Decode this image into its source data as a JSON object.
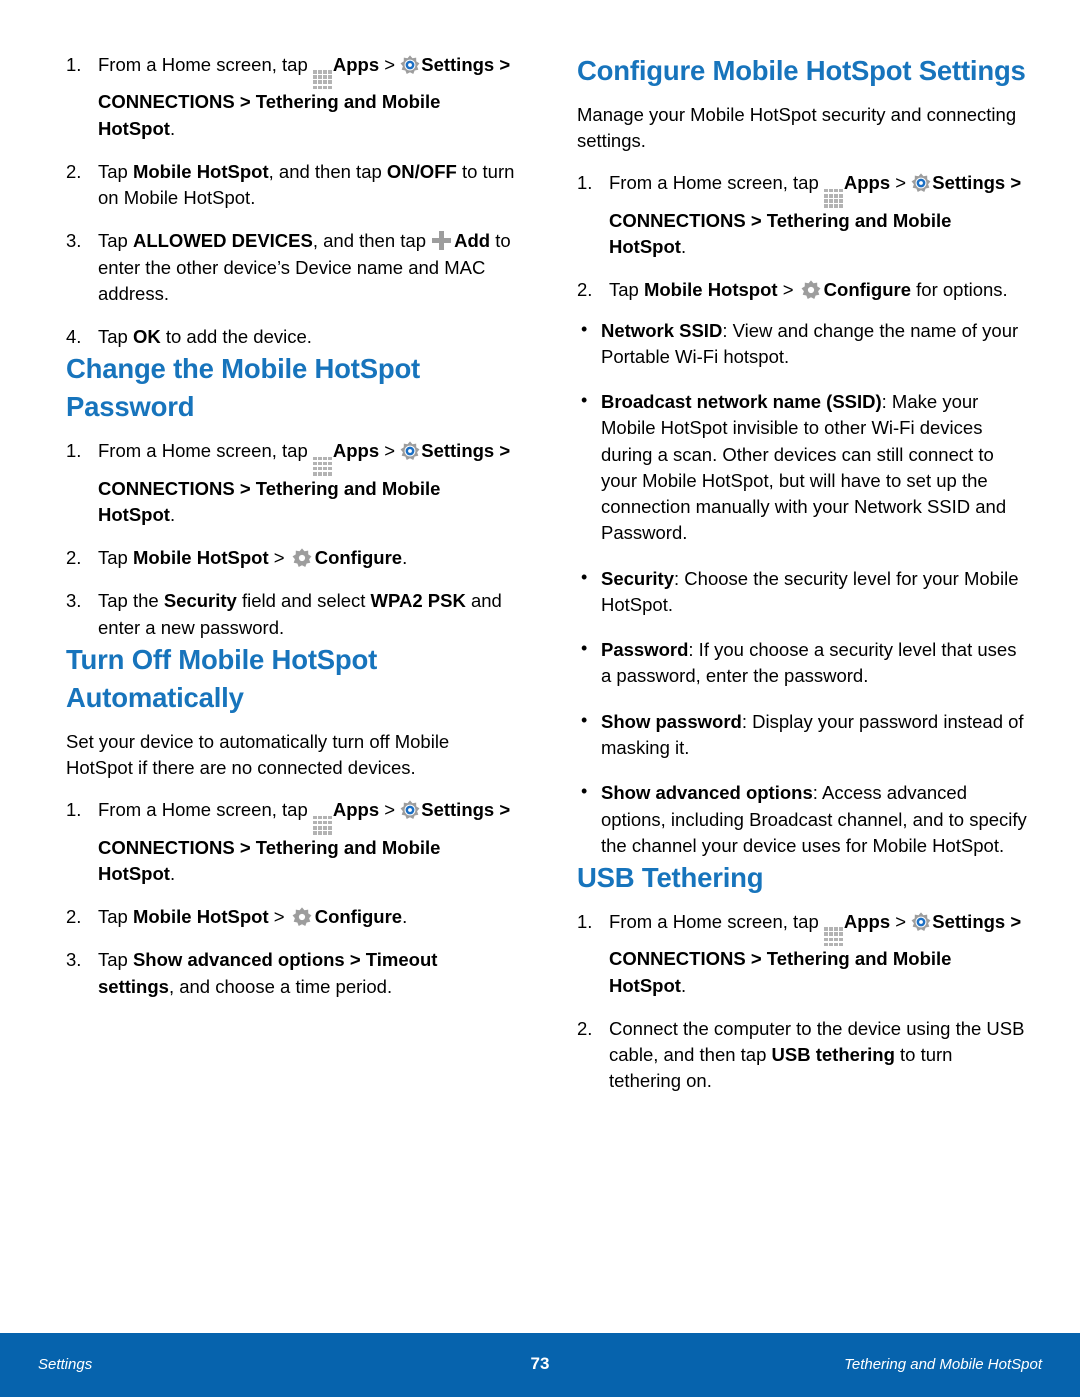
{
  "document": {
    "page_number": "73",
    "footer_left": "Settings",
    "footer_right": "Tethering and Mobile HotSpot"
  },
  "icons": {
    "apps": "apps-grid-icon",
    "settings": "settings-gear-icon",
    "configure": "configure-gear-icon",
    "add": "plus-add-icon"
  },
  "colors": {
    "heading_blue": "#1774bc",
    "footer_blue": "#0663ad",
    "icon_gray": "#9d9d9d",
    "gear_blue": "#1b6fc4"
  },
  "common": {
    "step_home_prefix": "From a Home screen, tap ",
    "apps_label": "Apps",
    "chevron_after_apps": " > ",
    "settings_label": "Settings",
    "settings_path": " > CONNECTIONS > Tethering and Mobile HotSpot",
    "settings_path_period": "."
  },
  "left_column": {
    "steps_top": {
      "items": [
        {
          "num": "1.",
          "kind": "home-path"
        },
        {
          "num": "2.",
          "parts": [
            {
              "t": "Tap ",
              "b": false
            },
            {
              "t": "Mobile HotSpot",
              "b": true
            },
            {
              "t": ", and then tap ",
              "b": false
            },
            {
              "t": "ON/OFF",
              "b": true
            },
            {
              "t": " to turn on Mobile HotSpot.",
              "b": false
            }
          ]
        },
        {
          "num": "3.",
          "kind": "add-step",
          "pre": [
            {
              "t": "Tap ",
              "b": false
            },
            {
              "t": "ALLOWED DEVICES",
              "b": true
            },
            {
              "t": ", and then tap ",
              "b": false
            }
          ],
          "add_label": "Add",
          "post": [
            {
              "t": " to enter the other device’s Device name and MAC address.",
              "b": false
            }
          ]
        },
        {
          "num": "4.",
          "parts": [
            {
              "t": "Tap ",
              "b": false
            },
            {
              "t": "OK",
              "b": true
            },
            {
              "t": " to add the device.",
              "b": false
            }
          ]
        }
      ]
    },
    "section_change_password": {
      "title": "Change the Mobile HotSpot Password",
      "items": [
        {
          "num": "1.",
          "kind": "home-path"
        },
        {
          "num": "2.",
          "kind": "configure-step",
          "pre": [
            {
              "t": "Tap ",
              "b": false
            },
            {
              "t": "Mobile HotSpot",
              "b": true
            },
            {
              "t": " > ",
              "b": false
            }
          ],
          "configure_label": "Configure",
          "post": [
            {
              "t": ".",
              "b": false
            }
          ]
        },
        {
          "num": "3.",
          "parts": [
            {
              "t": "Tap the ",
              "b": false
            },
            {
              "t": "Security",
              "b": true
            },
            {
              "t": " field and select ",
              "b": false
            },
            {
              "t": "WPA2 PSK",
              "b": true
            },
            {
              "t": " and enter a new password.",
              "b": false
            }
          ]
        }
      ]
    },
    "section_turn_off_auto": {
      "title": "Turn Off Mobile HotSpot Automatically",
      "intro": "Set your device to automatically turn off Mobile HotSpot if there are no connected devices.",
      "items": [
        {
          "num": "1.",
          "kind": "home-path"
        },
        {
          "num": "2.",
          "kind": "configure-step",
          "pre": [
            {
              "t": "Tap ",
              "b": false
            },
            {
              "t": "Mobile HotSpot",
              "b": true
            },
            {
              "t": " > ",
              "b": false
            }
          ],
          "configure_label": "Configure",
          "post": [
            {
              "t": ".",
              "b": false
            }
          ]
        },
        {
          "num": "3.",
          "parts": [
            {
              "t": "Tap ",
              "b": false
            },
            {
              "t": "Show advanced options > Timeout settings",
              "b": true
            },
            {
              "t": ", and choose a time period.",
              "b": false
            }
          ]
        }
      ]
    }
  },
  "right_column": {
    "section_configure_settings": {
      "title": "Configure Mobile HotSpot Settings",
      "intro": "Manage your Mobile HotSpot security and connecting settings.",
      "items": [
        {
          "num": "1.",
          "kind": "home-path"
        },
        {
          "num": "2.",
          "kind": "configure-step",
          "pre": [
            {
              "t": "Tap ",
              "b": false
            },
            {
              "t": "Mobile Hotspot",
              "b": true
            },
            {
              "t": " > ",
              "b": false
            }
          ],
          "configure_label": "Configure",
          "post": [
            {
              "t": " for options.",
              "b": false
            }
          ]
        }
      ],
      "bullets": [
        {
          "parts": [
            {
              "t": "Network SSID",
              "b": true
            },
            {
              "t": ": View and change the name of your Portable Wi-Fi hotspot.",
              "b": false
            }
          ]
        },
        {
          "parts": [
            {
              "t": "Broadcast network name (SSID)",
              "b": true
            },
            {
              "t": ": Make your Mobile HotSpot invisible to other Wi-Fi devices during a scan. Other devices can still connect to your Mobile HotSpot, but will have to set up the connection manually with your Network SSID and Password.",
              "b": false
            }
          ]
        },
        {
          "parts": [
            {
              "t": "Security",
              "b": true
            },
            {
              "t": ": Choose the security level for your Mobile HotSpot.",
              "b": false
            }
          ]
        },
        {
          "parts": [
            {
              "t": "Password",
              "b": true
            },
            {
              "t": ": If you choose a security level that uses a password, enter the password.",
              "b": false
            }
          ]
        },
        {
          "parts": [
            {
              "t": "Show password",
              "b": true
            },
            {
              "t": ": Display your password instead of masking it.",
              "b": false
            }
          ]
        },
        {
          "parts": [
            {
              "t": "Show advanced options",
              "b": true
            },
            {
              "t": ": Access advanced options, including Broadcast channel, and to specify the channel your device uses for Mobile HotSpot.",
              "b": false
            }
          ]
        }
      ]
    },
    "section_usb_tethering": {
      "title": "USB Tethering",
      "items": [
        {
          "num": "1.",
          "kind": "home-path"
        },
        {
          "num": "2.",
          "parts": [
            {
              "t": "Connect the computer to the device using the USB cable, and then tap ",
              "b": false
            },
            {
              "t": "USB tethering",
              "b": true
            },
            {
              "t": " to turn tethering on.",
              "b": false
            }
          ]
        }
      ]
    }
  }
}
